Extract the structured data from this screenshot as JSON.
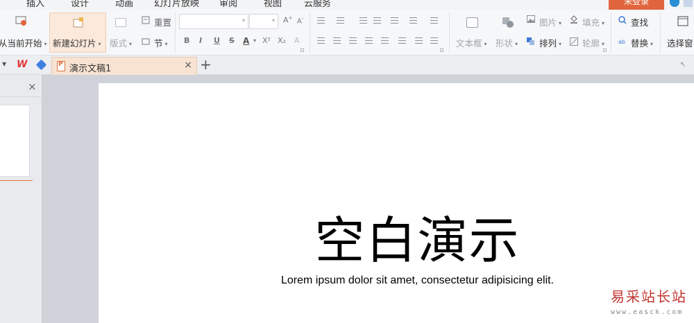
{
  "menu": {
    "tabs": [
      "插入",
      "设计",
      "动画",
      "幻灯片放映",
      "审阅",
      "视图",
      "云服务"
    ],
    "login_label": "未登录"
  },
  "ribbon": {
    "from_current": "从当前开始",
    "new_slide": "新建幻灯片",
    "layout": "版式",
    "reset": "重置",
    "section": "节",
    "bold": "B",
    "italic": "I",
    "underline": "U",
    "strike": "S",
    "font_color": "A",
    "superscript": "X²",
    "subscript": "X₂",
    "textbox": "文本框",
    "shape": "形状",
    "picture": "图片",
    "fill": "填充",
    "arrange": "排列",
    "outline": "轮廓",
    "find": "查找",
    "replace": "替换",
    "select_pane": "选择窗"
  },
  "tabs_bar": {
    "doc_tab_label": "演示文稿1",
    "close": "×",
    "add": "+"
  },
  "panel": {
    "close": "×"
  },
  "slide": {
    "title": "空白演示",
    "subtitle": "Lorem ipsum dolor sit amet, consectetur adipisicing elit."
  },
  "watermark": {
    "cn": "易采站长站",
    "url": "www.easck.com"
  },
  "colors": {
    "accent": "#e0653c",
    "doc_tab_bg": "#f8e3d2",
    "watermark": "#c0322d"
  }
}
